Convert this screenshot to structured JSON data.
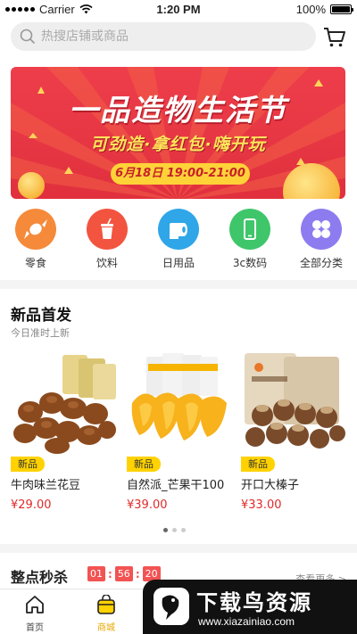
{
  "status_bar": {
    "carrier": "Carrier",
    "time": "1:20 PM",
    "battery": "100%"
  },
  "search": {
    "placeholder": "热搜店铺或商品"
  },
  "banner": {
    "title": "一品造物生活节",
    "subtitle": "可劲造·拿红包·嗨开玩",
    "date": "6月18日 19:00-21:00"
  },
  "categories": [
    {
      "label": "零食",
      "icon": "candy-icon",
      "color": "#f58a3b"
    },
    {
      "label": "饮料",
      "icon": "drink-icon",
      "color": "#f2543f"
    },
    {
      "label": "日用品",
      "icon": "tissue-roll-icon",
      "color": "#2fa6e8"
    },
    {
      "label": "3c数码",
      "icon": "phone-icon",
      "color": "#3fc66b"
    },
    {
      "label": "全部分类",
      "icon": "grid-clover-icon",
      "color": "#8d7cf0"
    }
  ],
  "new_products": {
    "title": "新品首发",
    "subtitle": "今日准时上新",
    "items": [
      {
        "tag": "新品",
        "name": "牛肉味兰花豆",
        "price": "¥29.00"
      },
      {
        "tag": "新品",
        "name": "自然派_芒果干100",
        "price": "¥39.00"
      },
      {
        "tag": "新品",
        "name": "开口大榛子",
        "price": "¥33.00"
      }
    ],
    "pager": {
      "total": 3,
      "active": 1
    }
  },
  "flash_sale": {
    "title": "整点秒杀",
    "timer": [
      "01",
      "56",
      "20"
    ],
    "more": "查看更多 >"
  },
  "tabbar": {
    "items": [
      {
        "label": "首页",
        "active": false
      },
      {
        "label": "商城",
        "active": true
      }
    ]
  },
  "watermark": {
    "text": "下载鸟资源",
    "url": "www.xiazainiao.com"
  }
}
